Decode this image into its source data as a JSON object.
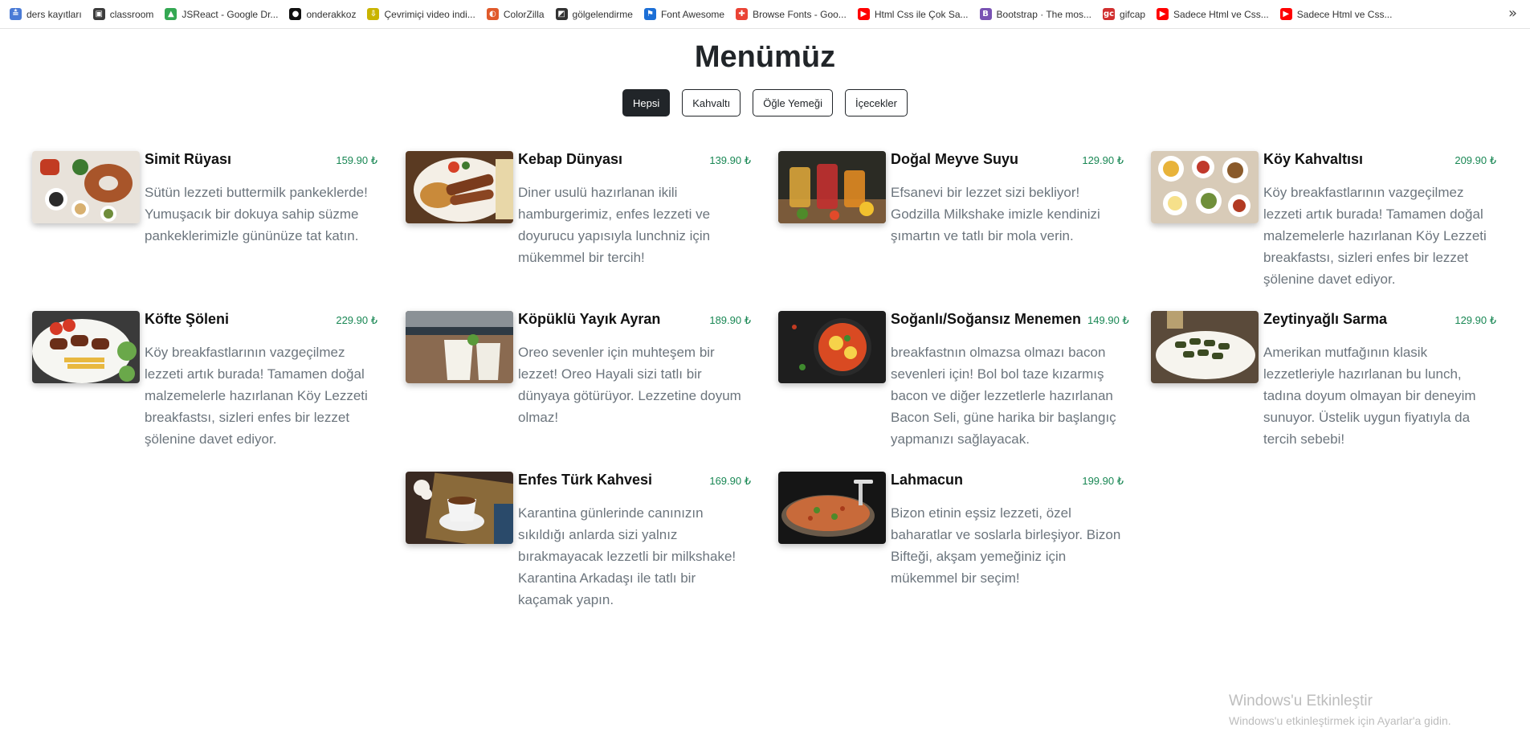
{
  "bookmarks": [
    {
      "label": "ders kayıtları",
      "icon": "ders-icon",
      "color": "#4a7bd6",
      "glyph": "≛"
    },
    {
      "label": "classroom",
      "icon": "classroom-icon",
      "color": "#3b3b3b",
      "glyph": "▣"
    },
    {
      "label": "JSReact - Google Dr...",
      "icon": "google-drive-icon",
      "color": "#34a853",
      "glyph": "▲"
    },
    {
      "label": "onderakkoz",
      "icon": "github-icon",
      "color": "#111111",
      "glyph": "●"
    },
    {
      "label": "Çevrimiçi video indi...",
      "icon": "download-icon",
      "color": "#c9b400",
      "glyph": "⇩"
    },
    {
      "label": "ColorZilla",
      "icon": "colorzilla-icon",
      "color": "#e05a2b",
      "glyph": "◐"
    },
    {
      "label": "gölgelendirme",
      "icon": "shadow-icon",
      "color": "#333333",
      "glyph": "◩"
    },
    {
      "label": "Font Awesome",
      "icon": "flag-icon",
      "color": "#1c6fd6",
      "glyph": "⚑"
    },
    {
      "label": "Browse Fonts - Goo...",
      "icon": "google-fonts-icon",
      "color": "#ea4335",
      "glyph": "✚"
    },
    {
      "label": "Html Css ile Çok Sa...",
      "icon": "youtube-icon",
      "color": "#ff0000",
      "glyph": "▶"
    },
    {
      "label": "Bootstrap · The mos...",
      "icon": "bootstrap-icon",
      "color": "#7952b3",
      "glyph": "B"
    },
    {
      "label": "gifcap",
      "icon": "gifcap-icon",
      "color": "#d12f2f",
      "glyph": "gc"
    },
    {
      "label": "Sadece Html ve Css...",
      "icon": "youtube-icon",
      "color": "#ff0000",
      "glyph": "▶"
    },
    {
      "label": "Sadece Html ve Css...",
      "icon": "youtube-icon",
      "color": "#ff0000",
      "glyph": "▶"
    }
  ],
  "bookmarks_more": "»",
  "page_title": "Menümüz",
  "filters": [
    {
      "label": "Hepsi",
      "active": true
    },
    {
      "label": "Kahvaltı",
      "active": false
    },
    {
      "label": "Öğle Yemeği",
      "active": false
    },
    {
      "label": "İçecekler",
      "active": false
    }
  ],
  "menu": [
    {
      "name": "Simit Rüyası",
      "price": "159.90 ₺",
      "image": "breakfast-spread",
      "desc": "Sütün lezzeti buttermilk pankeklerde! Yumuşacık bir dokuya sahip süzme pankeklerimizle gününüze tat katın."
    },
    {
      "name": "Kebap Dünyası",
      "price": "139.90 ₺",
      "image": "kebab-plate",
      "desc": "Diner usulü hazırlanan ikili hamburgerimiz, enfes lezzeti ve doyurucu yapısıyla lunchniz için mükemmel bir tercih!"
    },
    {
      "name": "Doğal Meyve Suyu",
      "price": "129.90 ₺",
      "image": "fruit-juices",
      "desc": "Efsanevi bir lezzet sizi bekliyor! Godzilla Milkshake imizle kendinizi şımartın ve tatlı bir mola verin."
    },
    {
      "name": "Köy Kahvaltısı",
      "price": "209.90 ₺",
      "image": "village-breakfast",
      "desc": "Köy breakfastlarının vazgeçilmez lezzeti artık burada! Tamamen doğal malzemelerle hazırlanan Köy Lezzeti breakfastsı, sizleri enfes bir lezzet şölenine davet ediyor."
    },
    {
      "name": "Köfte Şöleni",
      "price": "229.90 ₺",
      "image": "kofte-plate",
      "desc": "Köy breakfastlarının vazgeçilmez lezzeti artık burada! Tamamen doğal malzemelerle hazırlanan Köy Lezzeti breakfastsı, sizleri enfes bir lezzet şölenine davet ediyor."
    },
    {
      "name": "Köpüklü Yayık Ayran",
      "price": "189.90 ₺",
      "image": "ayran-glasses",
      "desc": "Oreo sevenler için muhteşem bir lezzet! Oreo Hayali sizi tatlı bir dünyaya götürüyor. Lezzetine doyum olmaz!"
    },
    {
      "name": "Soğanlı/Soğansız Menemen",
      "price": "149.90 ₺",
      "image": "menemen-pan",
      "desc": "breakfastnın olmazsa olmazı bacon sevenleri için! Bol bol taze kızarmış bacon ve diğer lezzetlerle hazırlanan Bacon Seli, güne harika bir başlangıç yapmanızı sağlayacak."
    },
    {
      "name": "Zeytinyağlı Sarma",
      "price": "129.90 ₺",
      "image": "sarma-plate",
      "desc": "Amerikan mutfağının klasik lezzetleriyle hazırlanan bu lunch, tadına doyum olmayan bir deneyim sunuyor. Üstelik uygun fiyatıyla da tercih sebebi!"
    },
    {
      "name": "Enfes Türk Kahvesi",
      "price": "169.90 ₺",
      "image": "turkish-coffee",
      "desc": "Karantina günlerinde canınızın sıkıldığı anlarda sizi yalnız bırakmayacak lezzetli bir milkshake! Karantina Arkadaşı ile tatlı bir kaçamak yapın."
    },
    {
      "name": "Lahmacun",
      "price": "199.90 ₺",
      "image": "lahmacun",
      "desc": "Bizon etinin eşsiz lezzeti, özel baharatlar ve soslarla birleşiyor. Bizon Bifteği, akşam yemeğiniz için mükemmel bir seçim!"
    }
  ],
  "watermark": {
    "line1": "Windows'u Etkinleştir",
    "line2": "Windows'u etkinleştirmek için Ayarlar'a gidin."
  },
  "colors": {
    "dark": "#212529",
    "price": "#198754",
    "desc": "#6c757d"
  }
}
